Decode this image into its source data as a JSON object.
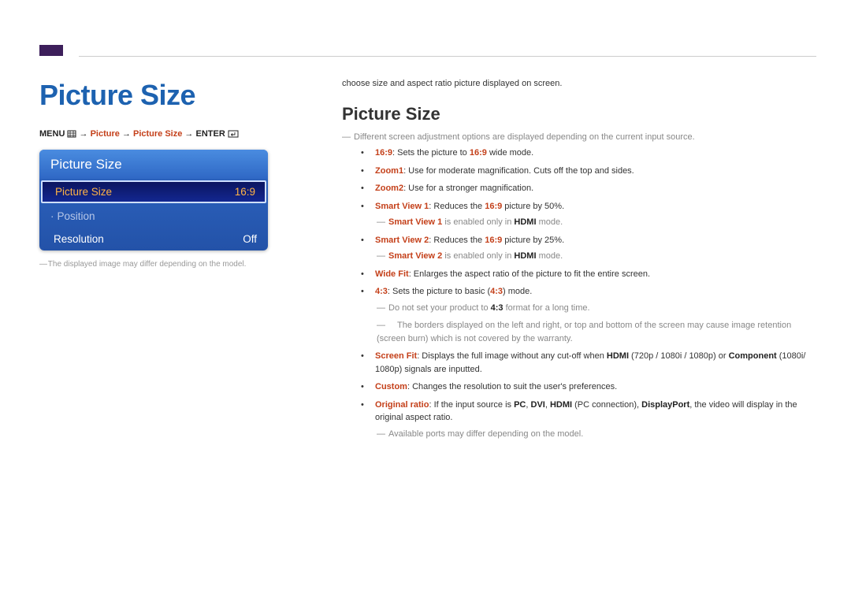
{
  "page": {
    "main_title": "Picture Size",
    "breadcrumb": {
      "menu": "MENU",
      "arrow": "→",
      "picture": "Picture",
      "picture_size": "Picture Size",
      "enter": "ENTER"
    },
    "menu_box": {
      "header": "Picture Size",
      "rows": [
        {
          "label": "Picture Size",
          "value": "16:9",
          "selected": true
        },
        {
          "label": "Position",
          "value": "",
          "dim": true,
          "prefix": "·"
        },
        {
          "label": "Resolution",
          "value": "Off"
        }
      ]
    },
    "caption": "The displayed image may differ depending on the model.",
    "right": {
      "intro": "choose size and aspect ratio picture displayed on screen.",
      "sub_title": "Picture Size",
      "note_top": "Different screen adjustment options are displayed depending on the current input source.",
      "items": {
        "i1_hl": "16:9",
        "i1_rest": ": Sets the picture to ",
        "i1_hl2": "16:9",
        "i1_tail": " wide mode.",
        "i2_hl": "Zoom1",
        "i2_rest": ": Use for moderate magnification. Cuts off the top and sides.",
        "i3_hl": "Zoom2",
        "i3_rest": ": Use for a stronger magnification.",
        "i4_hl": "Smart View 1",
        "i4_rest": ": Reduces the ",
        "i4_hl2": "16:9",
        "i4_tail": " picture by 50%.",
        "i4_note_a": "Smart View 1",
        "i4_note_b": " is enabled only in ",
        "i4_note_c": "HDMI",
        "i4_note_d": " mode.",
        "i5_hl": "Smart View 2",
        "i5_rest": ": Reduces the ",
        "i5_hl2": "16:9",
        "i5_tail": " picture by 25%.",
        "i5_note_a": "Smart View 2",
        "i5_note_b": " is enabled only in ",
        "i5_note_c": "HDMI",
        "i5_note_d": " mode.",
        "i6_hl": "Wide Fit",
        "i6_rest": ": Enlarges the aspect ratio of the picture to fit the entire screen.",
        "i7_hl": "4:3",
        "i7_rest": ": Sets the picture to basic (",
        "i7_hl2": "4:3",
        "i7_tail": ") mode.",
        "i7_note1_a": "Do not set your product to ",
        "i7_note1_b": "4:3",
        "i7_note1_c": " format for a long time.",
        "i7_note2": "The borders displayed on the left and right, or top and bottom of the screen may cause image retention (screen burn) which is not covered by the warranty.",
        "i8_hl": "Screen Fit",
        "i8_a": ": Displays the full image without any cut-off when ",
        "i8_b": "HDMI",
        "i8_c": " (720p / 1080i / 1080p) or ",
        "i8_d": "Component",
        "i8_e": " (1080i/ 1080p) signals are inputted.",
        "i9_hl": "Custom",
        "i9_rest": ": Changes the resolution to suit the user's preferences.",
        "i10_hl": "Original ratio",
        "i10_a": ": If the input source is ",
        "i10_b": "PC",
        "i10_c": ", ",
        "i10_d": "DVI",
        "i10_e": ", ",
        "i10_f": "HDMI",
        "i10_g": " (PC connection), ",
        "i10_h": "DisplayPort",
        "i10_i": ", the video will display in the original aspect ratio.",
        "i10_note": "Available ports may differ depending on the model."
      }
    }
  }
}
